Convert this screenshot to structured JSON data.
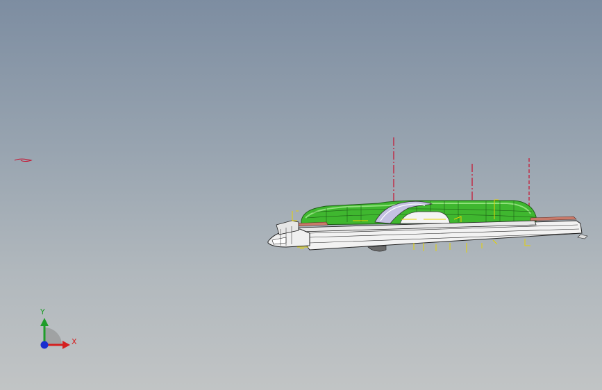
{
  "viewport": {
    "background_top": "#7d8da1",
    "background_bottom": "#c1c4c5"
  },
  "model": {
    "body_color": "#3fb72f",
    "body_highlight": "#8ee07a",
    "frame_color": "#f2f2f2",
    "edge_color": "#222222",
    "sketch_color": "#e6d300",
    "centerline_color": "#c8102e",
    "accent_color": "#c97a6a",
    "cover_color": "#b9b6d8"
  },
  "triad": {
    "x_label": "X",
    "y_label": "Y",
    "x_color": "#d42020",
    "y_color": "#1f9d2a",
    "z_color": "#1a2fd0"
  }
}
